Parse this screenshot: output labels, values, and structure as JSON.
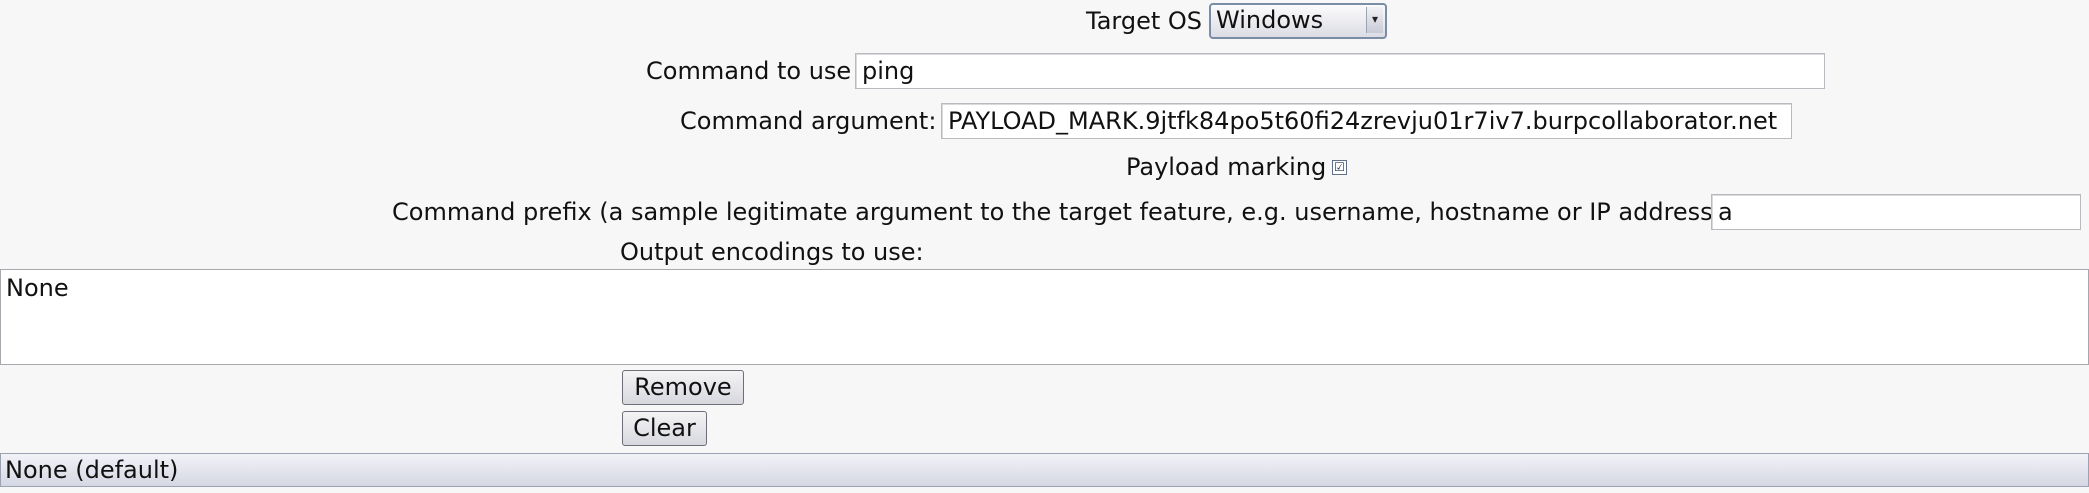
{
  "target_os": {
    "label": "Target OS",
    "selected": "Windows",
    "arrow_icon": "dropdown-arrow-icon"
  },
  "command": {
    "label": "Command to use",
    "value": "ping"
  },
  "argument": {
    "label": "Command argument:",
    "value": "PAYLOAD_MARK.9jtfk84po5t60fi24zrevju01r7iv7.burpcollaborator.net"
  },
  "payload_marking": {
    "label": "Payload marking",
    "checked": "☑"
  },
  "prefix": {
    "label": "Command prefix (a sample legitimate argument to the target feature, e.g. username, hostname or IP address)",
    "value": "a"
  },
  "encodings": {
    "label": "Output encodings to use:",
    "items": [
      "None"
    ],
    "remove_label": "Remove",
    "clear_label": "Clear",
    "combo_selected": "None (default)"
  }
}
